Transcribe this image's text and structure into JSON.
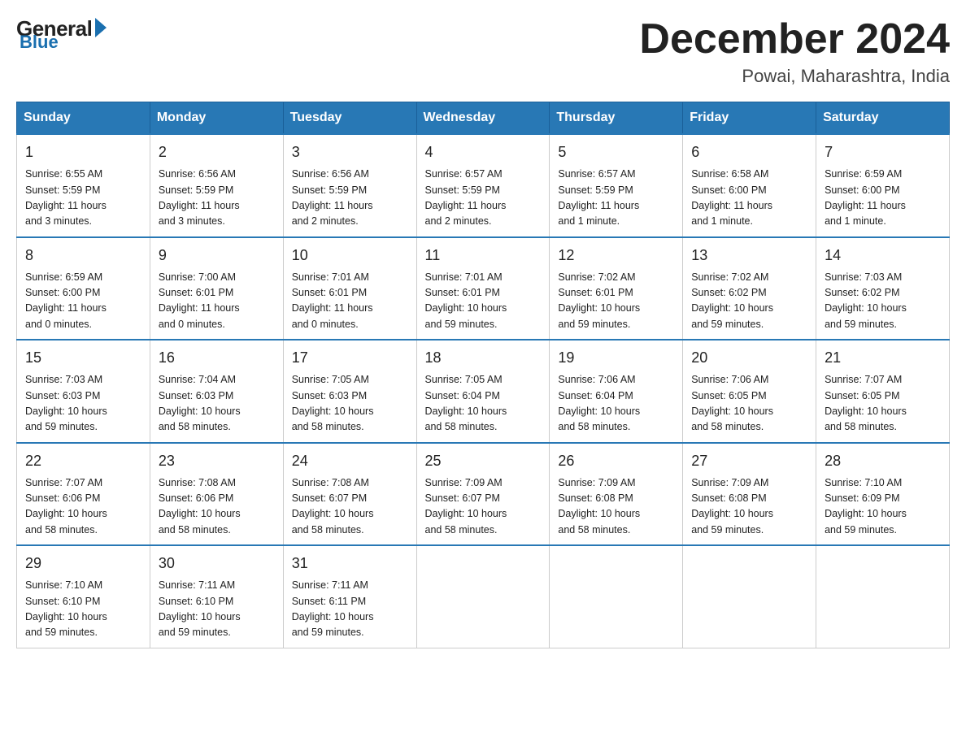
{
  "logo": {
    "general": "General",
    "blue": "Blue"
  },
  "title": {
    "month_year": "December 2024",
    "location": "Powai, Maharashtra, India"
  },
  "header_days": [
    "Sunday",
    "Monday",
    "Tuesday",
    "Wednesday",
    "Thursday",
    "Friday",
    "Saturday"
  ],
  "weeks": [
    [
      {
        "day": "1",
        "info": "Sunrise: 6:55 AM\nSunset: 5:59 PM\nDaylight: 11 hours\nand 3 minutes."
      },
      {
        "day": "2",
        "info": "Sunrise: 6:56 AM\nSunset: 5:59 PM\nDaylight: 11 hours\nand 3 minutes."
      },
      {
        "day": "3",
        "info": "Sunrise: 6:56 AM\nSunset: 5:59 PM\nDaylight: 11 hours\nand 2 minutes."
      },
      {
        "day": "4",
        "info": "Sunrise: 6:57 AM\nSunset: 5:59 PM\nDaylight: 11 hours\nand 2 minutes."
      },
      {
        "day": "5",
        "info": "Sunrise: 6:57 AM\nSunset: 5:59 PM\nDaylight: 11 hours\nand 1 minute."
      },
      {
        "day": "6",
        "info": "Sunrise: 6:58 AM\nSunset: 6:00 PM\nDaylight: 11 hours\nand 1 minute."
      },
      {
        "day": "7",
        "info": "Sunrise: 6:59 AM\nSunset: 6:00 PM\nDaylight: 11 hours\nand 1 minute."
      }
    ],
    [
      {
        "day": "8",
        "info": "Sunrise: 6:59 AM\nSunset: 6:00 PM\nDaylight: 11 hours\nand 0 minutes."
      },
      {
        "day": "9",
        "info": "Sunrise: 7:00 AM\nSunset: 6:01 PM\nDaylight: 11 hours\nand 0 minutes."
      },
      {
        "day": "10",
        "info": "Sunrise: 7:01 AM\nSunset: 6:01 PM\nDaylight: 11 hours\nand 0 minutes."
      },
      {
        "day": "11",
        "info": "Sunrise: 7:01 AM\nSunset: 6:01 PM\nDaylight: 10 hours\nand 59 minutes."
      },
      {
        "day": "12",
        "info": "Sunrise: 7:02 AM\nSunset: 6:01 PM\nDaylight: 10 hours\nand 59 minutes."
      },
      {
        "day": "13",
        "info": "Sunrise: 7:02 AM\nSunset: 6:02 PM\nDaylight: 10 hours\nand 59 minutes."
      },
      {
        "day": "14",
        "info": "Sunrise: 7:03 AM\nSunset: 6:02 PM\nDaylight: 10 hours\nand 59 minutes."
      }
    ],
    [
      {
        "day": "15",
        "info": "Sunrise: 7:03 AM\nSunset: 6:03 PM\nDaylight: 10 hours\nand 59 minutes."
      },
      {
        "day": "16",
        "info": "Sunrise: 7:04 AM\nSunset: 6:03 PM\nDaylight: 10 hours\nand 58 minutes."
      },
      {
        "day": "17",
        "info": "Sunrise: 7:05 AM\nSunset: 6:03 PM\nDaylight: 10 hours\nand 58 minutes."
      },
      {
        "day": "18",
        "info": "Sunrise: 7:05 AM\nSunset: 6:04 PM\nDaylight: 10 hours\nand 58 minutes."
      },
      {
        "day": "19",
        "info": "Sunrise: 7:06 AM\nSunset: 6:04 PM\nDaylight: 10 hours\nand 58 minutes."
      },
      {
        "day": "20",
        "info": "Sunrise: 7:06 AM\nSunset: 6:05 PM\nDaylight: 10 hours\nand 58 minutes."
      },
      {
        "day": "21",
        "info": "Sunrise: 7:07 AM\nSunset: 6:05 PM\nDaylight: 10 hours\nand 58 minutes."
      }
    ],
    [
      {
        "day": "22",
        "info": "Sunrise: 7:07 AM\nSunset: 6:06 PM\nDaylight: 10 hours\nand 58 minutes."
      },
      {
        "day": "23",
        "info": "Sunrise: 7:08 AM\nSunset: 6:06 PM\nDaylight: 10 hours\nand 58 minutes."
      },
      {
        "day": "24",
        "info": "Sunrise: 7:08 AM\nSunset: 6:07 PM\nDaylight: 10 hours\nand 58 minutes."
      },
      {
        "day": "25",
        "info": "Sunrise: 7:09 AM\nSunset: 6:07 PM\nDaylight: 10 hours\nand 58 minutes."
      },
      {
        "day": "26",
        "info": "Sunrise: 7:09 AM\nSunset: 6:08 PM\nDaylight: 10 hours\nand 58 minutes."
      },
      {
        "day": "27",
        "info": "Sunrise: 7:09 AM\nSunset: 6:08 PM\nDaylight: 10 hours\nand 59 minutes."
      },
      {
        "day": "28",
        "info": "Sunrise: 7:10 AM\nSunset: 6:09 PM\nDaylight: 10 hours\nand 59 minutes."
      }
    ],
    [
      {
        "day": "29",
        "info": "Sunrise: 7:10 AM\nSunset: 6:10 PM\nDaylight: 10 hours\nand 59 minutes."
      },
      {
        "day": "30",
        "info": "Sunrise: 7:11 AM\nSunset: 6:10 PM\nDaylight: 10 hours\nand 59 minutes."
      },
      {
        "day": "31",
        "info": "Sunrise: 7:11 AM\nSunset: 6:11 PM\nDaylight: 10 hours\nand 59 minutes."
      },
      {
        "day": "",
        "info": ""
      },
      {
        "day": "",
        "info": ""
      },
      {
        "day": "",
        "info": ""
      },
      {
        "day": "",
        "info": ""
      }
    ]
  ]
}
